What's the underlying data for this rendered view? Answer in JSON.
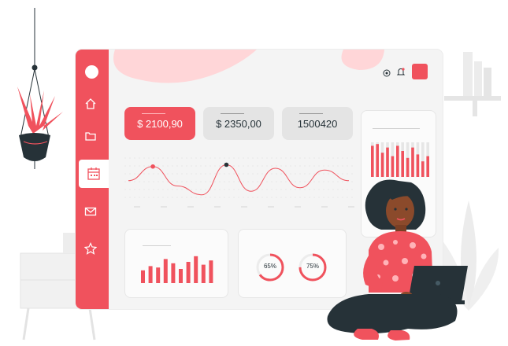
{
  "colors": {
    "accent": "#f0525d",
    "panel": "#f3f3f3",
    "card_gray": "#e4e4e4",
    "dark": "#263238"
  },
  "sidebar": {
    "items": [
      {
        "icon": "avatar-circle"
      },
      {
        "icon": "home-icon"
      },
      {
        "icon": "folder-icon"
      },
      {
        "icon": "calendar-icon",
        "active": true
      },
      {
        "icon": "mail-icon"
      },
      {
        "icon": "star-icon"
      }
    ]
  },
  "header": {
    "icons": [
      "settings-icon",
      "bell-icon",
      "profile-square"
    ]
  },
  "stats": [
    {
      "value": "$ 2100,90",
      "style": "accent"
    },
    {
      "value": "$ 2350,00",
      "style": "muted"
    },
    {
      "value": "1500420",
      "style": "muted"
    }
  ],
  "line_chart": {
    "values": [
      0.55,
      0.15,
      0.7,
      0.95,
      0.1,
      0.85,
      0.2,
      0.75,
      0.25,
      0.55
    ],
    "highlight_max": 1,
    "highlight_min": 4
  },
  "bar_chart": {
    "values": [
      0.45,
      0.6,
      0.55,
      0.85,
      0.7,
      0.5,
      0.75,
      0.95,
      0.65,
      0.8
    ]
  },
  "side_bars": {
    "values": [
      0.9,
      0.95,
      0.7,
      0.85,
      0.6,
      0.9,
      0.75,
      0.55,
      0.85,
      0.65,
      0.45,
      0.6
    ]
  },
  "donuts": [
    {
      "label": "65%",
      "fraction": 0.65
    },
    {
      "label": "75%",
      "fraction": 0.75
    }
  ]
}
